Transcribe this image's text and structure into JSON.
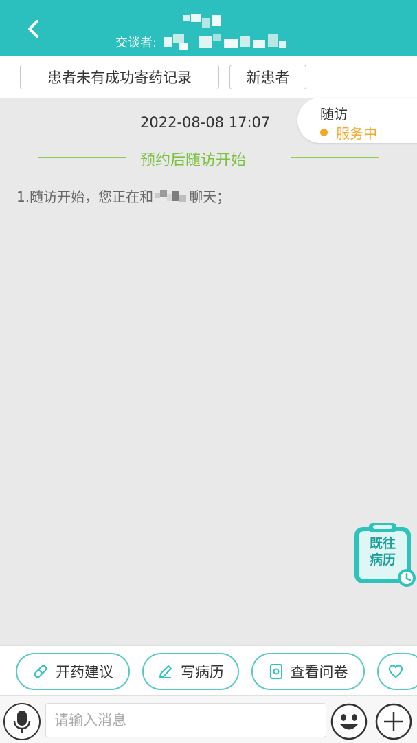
{
  "header": {
    "conversant_label": "交谈者:"
  },
  "tags": [
    "患者未有成功寄药记录",
    "新患者"
  ],
  "chat": {
    "timestamp": "2022-08-08 17:07",
    "follow_up": {
      "title": "随访",
      "status": "服务中"
    },
    "divider_text": "预约后随访开始",
    "system_prefix": "1.随访开始，您正在和",
    "system_suffix": "聊天；",
    "history_label_line1": "既往",
    "history_label_line2": "病历"
  },
  "actions": {
    "prescribe": "开药建议",
    "write_record": "写病历",
    "view_questionnaire": "查看问卷"
  },
  "input": {
    "placeholder": "请输入消息"
  },
  "colors": {
    "header_bg": "#2bbfbd",
    "accent_green": "#7cc241",
    "status_orange": "#f5a623",
    "action_border": "#57c9c4"
  },
  "icons": [
    "back-arrow-icon",
    "pill-icon",
    "pencil-icon",
    "questionnaire-icon",
    "heart-icon",
    "clock-icon",
    "mic-icon",
    "emoji-icon",
    "plus-icon"
  ]
}
